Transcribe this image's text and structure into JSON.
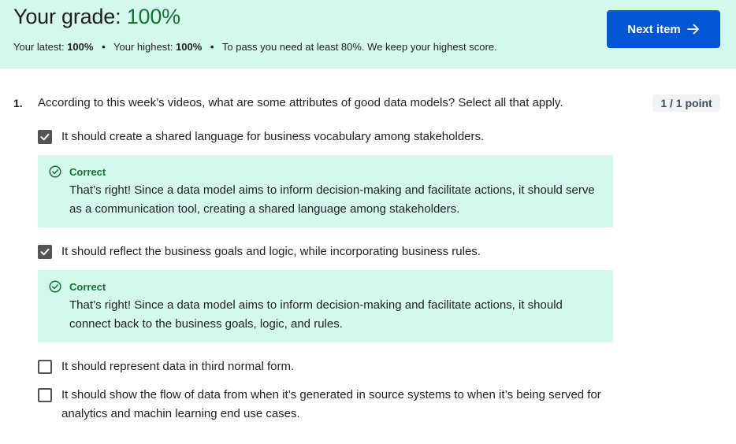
{
  "banner": {
    "title_prefix": "Your grade: ",
    "title_grade": "100%",
    "latest_label": "Your latest: ",
    "latest_value": "100%",
    "highest_label": "Your highest: ",
    "highest_value": "100%",
    "pass_note": "To pass you need at least 80%. We keep your highest score.",
    "separator": "•",
    "next_button": "Next item",
    "next_icon": "arrow-right-icon"
  },
  "question": {
    "number": "1.",
    "text": "According to this week’s videos, what are some attributes of good data models? Select all that apply.",
    "points": "1 / 1 point",
    "options": [
      {
        "label": "It should create a shared language for business vocabulary among stakeholders.",
        "checked": true,
        "feedback": {
          "label": "Correct",
          "text": "That’s right! Since a data model aims to inform decision-making and facilitate actions, it should serve as a communication tool, creating a shared language among stakeholders."
        }
      },
      {
        "label": "It should reflect the business goals and logic, while incorporating business rules.",
        "checked": true,
        "feedback": {
          "label": "Correct",
          "text": "That’s right! Since a data model aims to inform decision-making and facilitate actions, it should connect back to the business goals, logic, and rules."
        }
      },
      {
        "label": "It should represent data in third normal form.",
        "checked": false
      },
      {
        "label": "It should show the flow of data from when it’s generated in source systems to when it’s being served for analytics and machin learning end use cases.",
        "checked": false
      }
    ]
  },
  "colors": {
    "banner_bg": "#d5f8ec",
    "grade_green": "#137333",
    "primary_button": "#0056d2",
    "checkbox_checked": "#545454"
  }
}
